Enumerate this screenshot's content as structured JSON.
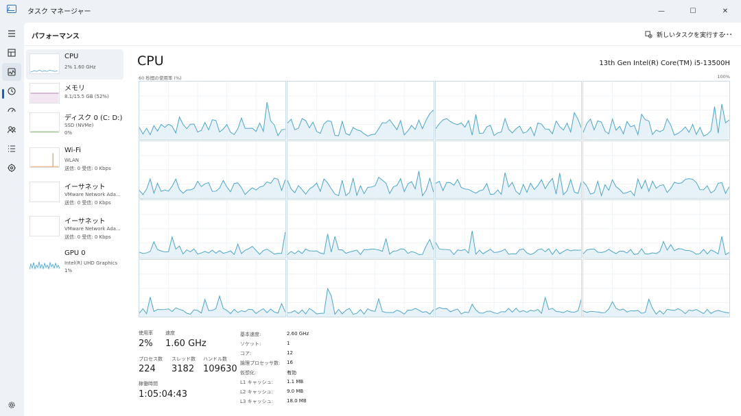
{
  "window": {
    "title": "タスク マネージャー",
    "minimize_glyph": "—",
    "maximize_glyph": "☐",
    "close_glyph": "✕"
  },
  "rail": {
    "icons": [
      "menu-icon",
      "processes-icon",
      "performance-icon",
      "app-history-icon",
      "startup-apps-icon",
      "users-icon",
      "details-icon",
      "services-icon",
      "settings-icon"
    ],
    "active": "performance-icon"
  },
  "header": {
    "title": "パフォーマンス",
    "run_task_label": "新しいタスクを実行する",
    "more_label": "…"
  },
  "resources": [
    {
      "name": "CPU",
      "lines": [
        "2%  1.60 GHz"
      ],
      "selected": true
    },
    {
      "name": "メモリ",
      "lines": [
        "8.1/15.5 GB (52%)"
      ],
      "selected": false
    },
    {
      "name": "ディスク 0 (C: D:)",
      "lines": [
        "SSD (NVMe)",
        "0%"
      ],
      "selected": false
    },
    {
      "name": "Wi-Fi",
      "lines": [
        "WLAN",
        "送信: 0  受信: 0 Kbps"
      ],
      "selected": false
    },
    {
      "name": "イーサネット",
      "lines": [
        "VMware Network Ada...",
        "送信: 0  受信: 0 Kbps"
      ],
      "selected": false
    },
    {
      "name": "イーサネット",
      "lines": [
        "VMware Network Ada...",
        "送信: 0  受信: 0 Kbps"
      ],
      "selected": false
    },
    {
      "name": "GPU 0",
      "lines": [
        "Intel(R) UHD Graphics",
        "1%"
      ],
      "selected": false
    }
  ],
  "cpu": {
    "title": "CPU",
    "model": "13th Gen Intel(R) Core(TM) i5-13500H",
    "axis_left": "60 秒間の使用率 (%)",
    "axis_right": "100%",
    "core_count": 16,
    "colors": {
      "line": "#4aa3c9",
      "fill": "#e6f2f8",
      "grid": "#eef3f7",
      "border": "#c9dbe8"
    }
  },
  "stats": {
    "usage": {
      "label": "使用率",
      "value": "2%"
    },
    "speed": {
      "label": "速度",
      "value": "1.60 GHz"
    },
    "processes": {
      "label": "プロセス数",
      "value": "224"
    },
    "threads": {
      "label": "スレッド数",
      "value": "3182"
    },
    "handles": {
      "label": "ハンドル数",
      "value": "109630"
    },
    "uptime": {
      "label": "稼働時間",
      "value": "1:05:04:43"
    }
  },
  "specs": [
    {
      "label": "基本速度:",
      "value": "2.60 GHz"
    },
    {
      "label": "ソケット:",
      "value": "1"
    },
    {
      "label": "コア:",
      "value": "12"
    },
    {
      "label": "論理プロセッサ数:",
      "value": "16"
    },
    {
      "label": "仮想化:",
      "value": "有効"
    },
    {
      "label": "L1 キャッシュ:",
      "value": "1.1 MB"
    },
    {
      "label": "L2 キャッシュ:",
      "value": "9.0 MB"
    },
    {
      "label": "L3 キャッシュ:",
      "value": "18.0 MB"
    }
  ]
}
